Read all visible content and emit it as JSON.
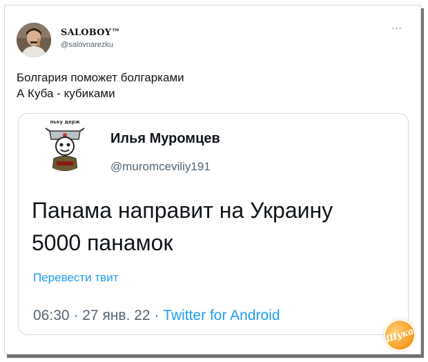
{
  "tweet": {
    "author_name": "SALOBOY™",
    "author_handle": "@salovnarezku",
    "more_icon": "more-dots-icon",
    "text_lines": [
      "Болгария поможет болгарками",
      "А Куба - кубиками"
    ]
  },
  "quoted": {
    "author_name": "Илья Муромцев",
    "author_handle": "@muromceviliy191",
    "avatar_caption_top": "льку держ",
    "text_lines": [
      "Панама направит на Украину",
      "5000 панамок"
    ],
    "translate_label": "Перевести твит",
    "time": "06:30",
    "separator": "·",
    "date": "27 янв. 22",
    "source": "Twitter for Android"
  },
  "watermark": {
    "text": "Шука"
  },
  "colors": {
    "text": "#0f1419",
    "secondary": "#536471",
    "link": "#1d9bf0",
    "border": "#cfd9de",
    "watermark": "#f39a1e"
  }
}
